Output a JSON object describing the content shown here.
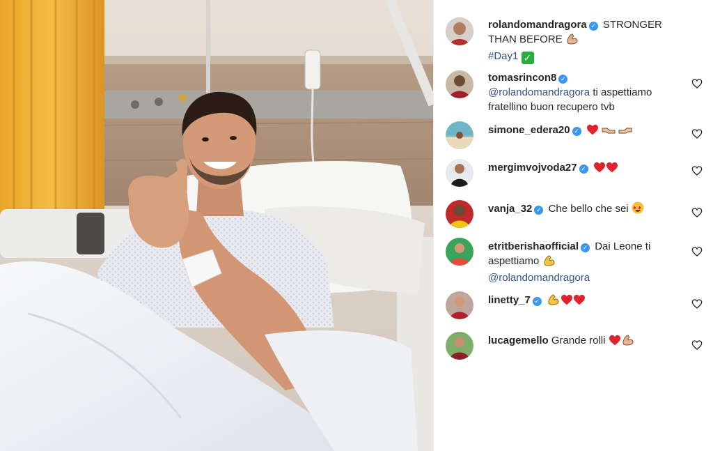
{
  "post": {
    "author": "rolandomandragora",
    "caption_line1": "STRONGER",
    "caption_line2": "THAN BEFORE",
    "hashtag": "#Day1",
    "caption_emoji": "flexed-biceps",
    "hashtag_emoji": "check-mark-button"
  },
  "comments": [
    {
      "user": "tomasrincon8",
      "verified": true,
      "mention": "@rolandomandragora",
      "text": "ti aspettiamo fratellino buon recupero tvb",
      "emojis": []
    },
    {
      "user": "simone_edera20",
      "verified": true,
      "text": "",
      "emojis": [
        "red-heart",
        "handshake",
        "handshake"
      ]
    },
    {
      "user": "mergimvojvoda27",
      "verified": true,
      "text": "",
      "emojis": [
        "red-heart",
        "red-heart"
      ]
    },
    {
      "user": "vanja_32",
      "verified": true,
      "text": "Che bello che sei",
      "emojis": [
        "star-struck"
      ]
    },
    {
      "user": "etritberishaofficial",
      "verified": true,
      "text": "Dai Leone ti aspettiamo",
      "mention": "@rolandomandragora",
      "emojis": [
        "flexed-biceps"
      ]
    },
    {
      "user": "linetty_7",
      "verified": true,
      "text": "",
      "emojis": [
        "flexed-biceps",
        "red-heart",
        "red-heart"
      ]
    },
    {
      "user": "lucagemello",
      "verified": false,
      "text": "Grande rolli",
      "emojis": [
        "red-heart",
        "flexed-biceps"
      ]
    }
  ],
  "icons": {
    "like": "heart-outline-icon",
    "verified": "verified-badge-icon"
  },
  "colors": {
    "verified": "#3897f0",
    "mention": "#385185",
    "heart": "#e0242f",
    "text": "#262626"
  }
}
